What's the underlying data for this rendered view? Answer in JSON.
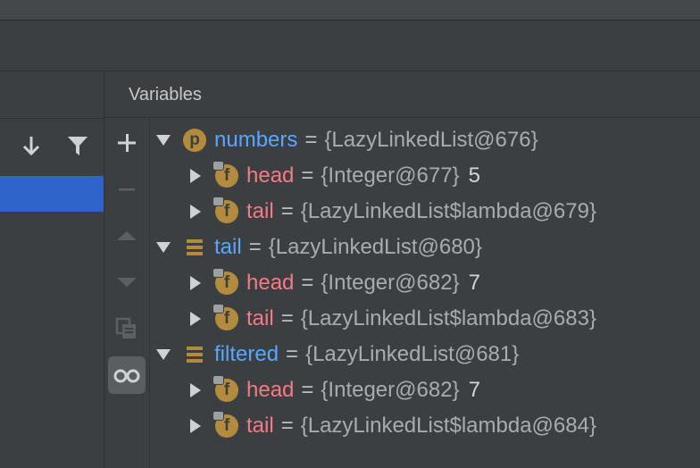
{
  "panel": {
    "title": "Variables"
  },
  "colors": {
    "selection": "#2f65ca",
    "var_name": "#58a6ff",
    "field_name": "#f47a86",
    "icon": "#b48a3d"
  },
  "left_toolbar": {
    "buttons": [
      {
        "name": "step-into-icon",
        "glyph": "↓"
      },
      {
        "name": "filter-icon",
        "glyph": ""
      }
    ]
  },
  "vars_toolbar": {
    "buttons": [
      {
        "name": "add-watch-icon",
        "glyph": "+"
      },
      {
        "name": "remove-watch-icon",
        "glyph": "−"
      },
      {
        "name": "move-up-icon",
        "glyph": "▲"
      },
      {
        "name": "move-down-icon",
        "glyph": "▼"
      },
      {
        "name": "copy-icon",
        "glyph": ""
      },
      {
        "name": "show-watches-glasses-icon",
        "glyph": ""
      }
    ]
  },
  "tree": [
    {
      "depth": 0,
      "expanded": true,
      "icon": "p",
      "name": "numbers",
      "eq": "=",
      "value": "{LazyLinkedList@676}",
      "extra": ""
    },
    {
      "depth": 1,
      "expanded": false,
      "icon": "f",
      "name": "head",
      "eq": "=",
      "value": "{Integer@677}",
      "extra": "5"
    },
    {
      "depth": 1,
      "expanded": false,
      "icon": "f",
      "name": "tail",
      "eq": "=",
      "value": "{LazyLinkedList$lambda@679}",
      "extra": ""
    },
    {
      "depth": 0,
      "expanded": true,
      "icon": "list",
      "name": "tail",
      "eq": "=",
      "value": "{LazyLinkedList@680}",
      "extra": ""
    },
    {
      "depth": 1,
      "expanded": false,
      "icon": "f",
      "name": "head",
      "eq": "=",
      "value": "{Integer@682}",
      "extra": "7"
    },
    {
      "depth": 1,
      "expanded": false,
      "icon": "f",
      "name": "tail",
      "eq": "=",
      "value": "{LazyLinkedList$lambda@683}",
      "extra": ""
    },
    {
      "depth": 0,
      "expanded": true,
      "icon": "list",
      "name": "filtered",
      "eq": "=",
      "value": "{LazyLinkedList@681}",
      "extra": ""
    },
    {
      "depth": 1,
      "expanded": false,
      "icon": "f",
      "name": "head",
      "eq": "=",
      "value": "{Integer@682}",
      "extra": "7"
    },
    {
      "depth": 1,
      "expanded": false,
      "icon": "f",
      "name": "tail",
      "eq": "=",
      "value": "{LazyLinkedList$lambda@684}",
      "extra": ""
    }
  ]
}
